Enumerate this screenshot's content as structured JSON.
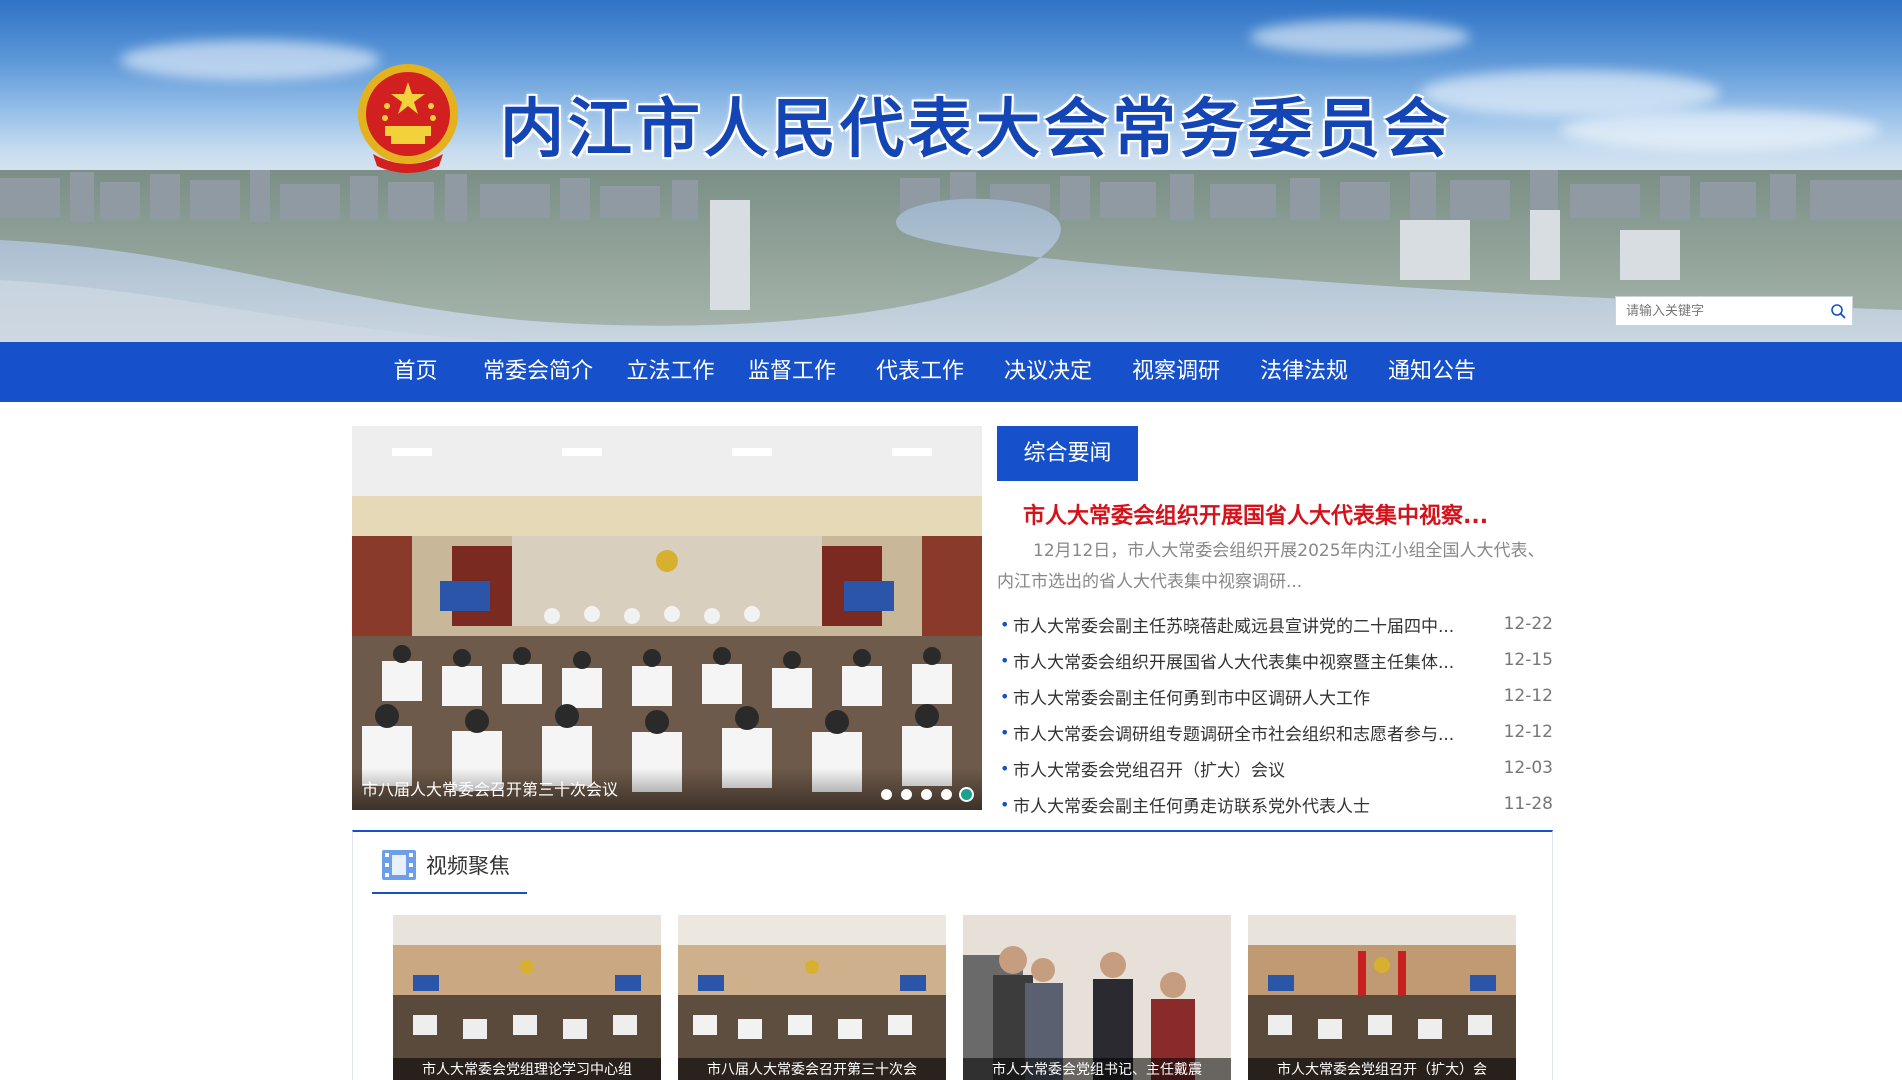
{
  "header": {
    "site_title": "内江市人民代表大会常务委员会",
    "search_placeholder": "请输入关键字"
  },
  "nav": {
    "items": [
      {
        "label": "首页"
      },
      {
        "label": "常委会简介"
      },
      {
        "label": "立法工作"
      },
      {
        "label": "监督工作"
      },
      {
        "label": "代表工作"
      },
      {
        "label": "决议决定"
      },
      {
        "label": "视察调研"
      },
      {
        "label": "法律法规"
      },
      {
        "label": "通知公告"
      }
    ]
  },
  "carousel": {
    "caption": "市八届人大常委会召开第三十次会议",
    "slide_count": 5,
    "active_index": 4
  },
  "news": {
    "tab_label": "综合要闻",
    "headline": "市人大常委会组织开展国省人大代表集中视察...",
    "summary": "12月12日，市人大常委会组织开展2025年内江小组全国人大代表、内江市选出的省人大代表集中视察调研...",
    "items": [
      {
        "title": "市人大常委会副主任苏晓蓓赴威远县宣讲党的二十届四中...",
        "date": "12-22"
      },
      {
        "title": "市人大常委会组织开展国省人大代表集中视察暨主任集体...",
        "date": "12-15"
      },
      {
        "title": "市人大常委会副主任何勇到市中区调研人大工作",
        "date": "12-12"
      },
      {
        "title": "市人大常委会调研组专题调研全市社会组织和志愿者参与...",
        "date": "12-12"
      },
      {
        "title": "市人大常委会党组召开（扩大）会议",
        "date": "12-03"
      },
      {
        "title": "市人大常委会副主任何勇走访联系党外代表人士",
        "date": "11-28"
      }
    ]
  },
  "video_focus": {
    "heading": "视频聚焦",
    "items": [
      {
        "caption": "市人大常委会党组理论学习中心组"
      },
      {
        "caption": "市八届人大常委会召开第三十次会"
      },
      {
        "caption": "市人大常委会党组书记、主任戴震"
      },
      {
        "caption": "市人大常委会党组召开（扩大）会"
      }
    ]
  },
  "colors": {
    "brand_blue": "#1651cb",
    "headline_red": "#d3121b",
    "carousel_active_dot": "#19a38f"
  }
}
